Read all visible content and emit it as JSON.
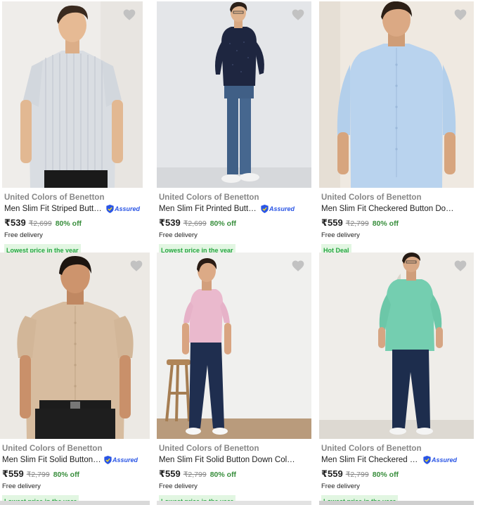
{
  "products": [
    {
      "brand": "United Colors of Benetton",
      "title": "Men Slim Fit Striped Button Dow...",
      "assured": true,
      "assured_label": "Assured",
      "price": "₹539",
      "mrp": "₹2,699",
      "discount": "80% off",
      "delivery": "Free delivery",
      "tag": "Lowest price in the year",
      "image": "man-in-striped-light-blue-shirt-photo"
    },
    {
      "brand": "United Colors of Benetton",
      "title": "Men Slim Fit Printed Button Dow...",
      "assured": true,
      "assured_label": "Assured",
      "price": "₹539",
      "mrp": "₹2,699",
      "discount": "80% off",
      "delivery": "Free delivery",
      "tag": "Lowest price in the year",
      "image": "man-in-navy-printed-shirt-photo"
    },
    {
      "brand": "United Colors of Benetton",
      "title": "Men Slim Fit Checkered Button Down Collar ...",
      "assured": false,
      "price": "₹559",
      "mrp": "₹2,799",
      "discount": "80% off",
      "delivery": "Free delivery",
      "tag": "Hot Deal",
      "image": "man-in-light-blue-shirt-photo"
    },
    {
      "brand": "United Colors of Benetton",
      "title": "Men Slim Fit Solid Button Down ...",
      "assured": true,
      "assured_label": "Assured",
      "price": "₹559",
      "mrp": "₹2,799",
      "discount": "80% off",
      "delivery": "Free delivery",
      "tag": "Lowest price in the year",
      "image": "man-in-beige-shirt-photo"
    },
    {
      "brand": "United Colors of Benetton",
      "title": "Men Slim Fit Solid Button Down Collar Casual...",
      "assured": false,
      "price": "₹559",
      "mrp": "₹2,799",
      "discount": "80% off",
      "delivery": "Free delivery",
      "tag": "Lowest price in the year",
      "image": "man-in-pink-shirt-photo"
    },
    {
      "brand": "United Colors of Benetton",
      "title": "Men Slim Fit Checkered Button ...",
      "assured": true,
      "assured_label": "Assured",
      "price": "₹559",
      "mrp": "₹2,799",
      "discount": "80% off",
      "delivery": "Free delivery",
      "tag": "Lowest price in the year",
      "image": "man-in-green-shirt-photo"
    }
  ],
  "colors": {
    "accent_green": "#388e3c",
    "tag_bg": "#e2f6e2",
    "tag_text": "#26a541",
    "assured_blue": "#2a55e5",
    "muted": "#878787",
    "heart": "#c2c2c2"
  }
}
